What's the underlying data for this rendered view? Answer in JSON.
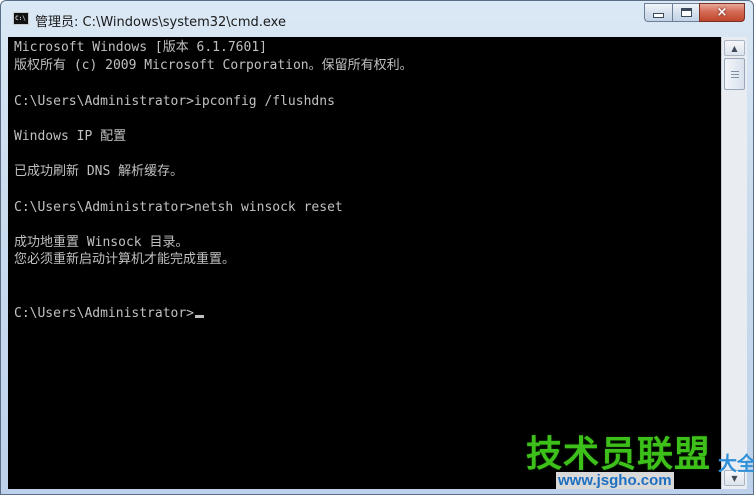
{
  "window": {
    "title": "管理员: C:\\Windows\\system32\\cmd.exe",
    "icon": "cmd-icon",
    "controls": {
      "minimize": "minimize-icon",
      "maximize": "maximize-icon",
      "close": "×"
    }
  },
  "console": {
    "lines": [
      "Microsoft Windows [版本 6.1.7601]",
      "版权所有 (c) 2009 Microsoft Corporation。保留所有权利。",
      "C:\\Users\\Administrator>ipconfig /flushdns",
      "Windows IP 配置",
      "已成功刷新 DNS 解析缓存。",
      "C:\\Users\\Administrator>netsh winsock reset",
      "成功地重置 Winsock 目录。",
      "您必须重新启动计算机才能完成重置。",
      "C:\\Users\\Administrator>"
    ],
    "text_color": "#c0c0c0",
    "background": "#000000"
  },
  "scrollbar": {
    "up_arrow": "▲",
    "down_arrow": "▼"
  },
  "watermark": {
    "title": "技术员联盟",
    "suffix": "大全",
    "url": "www.jsgho.com"
  }
}
